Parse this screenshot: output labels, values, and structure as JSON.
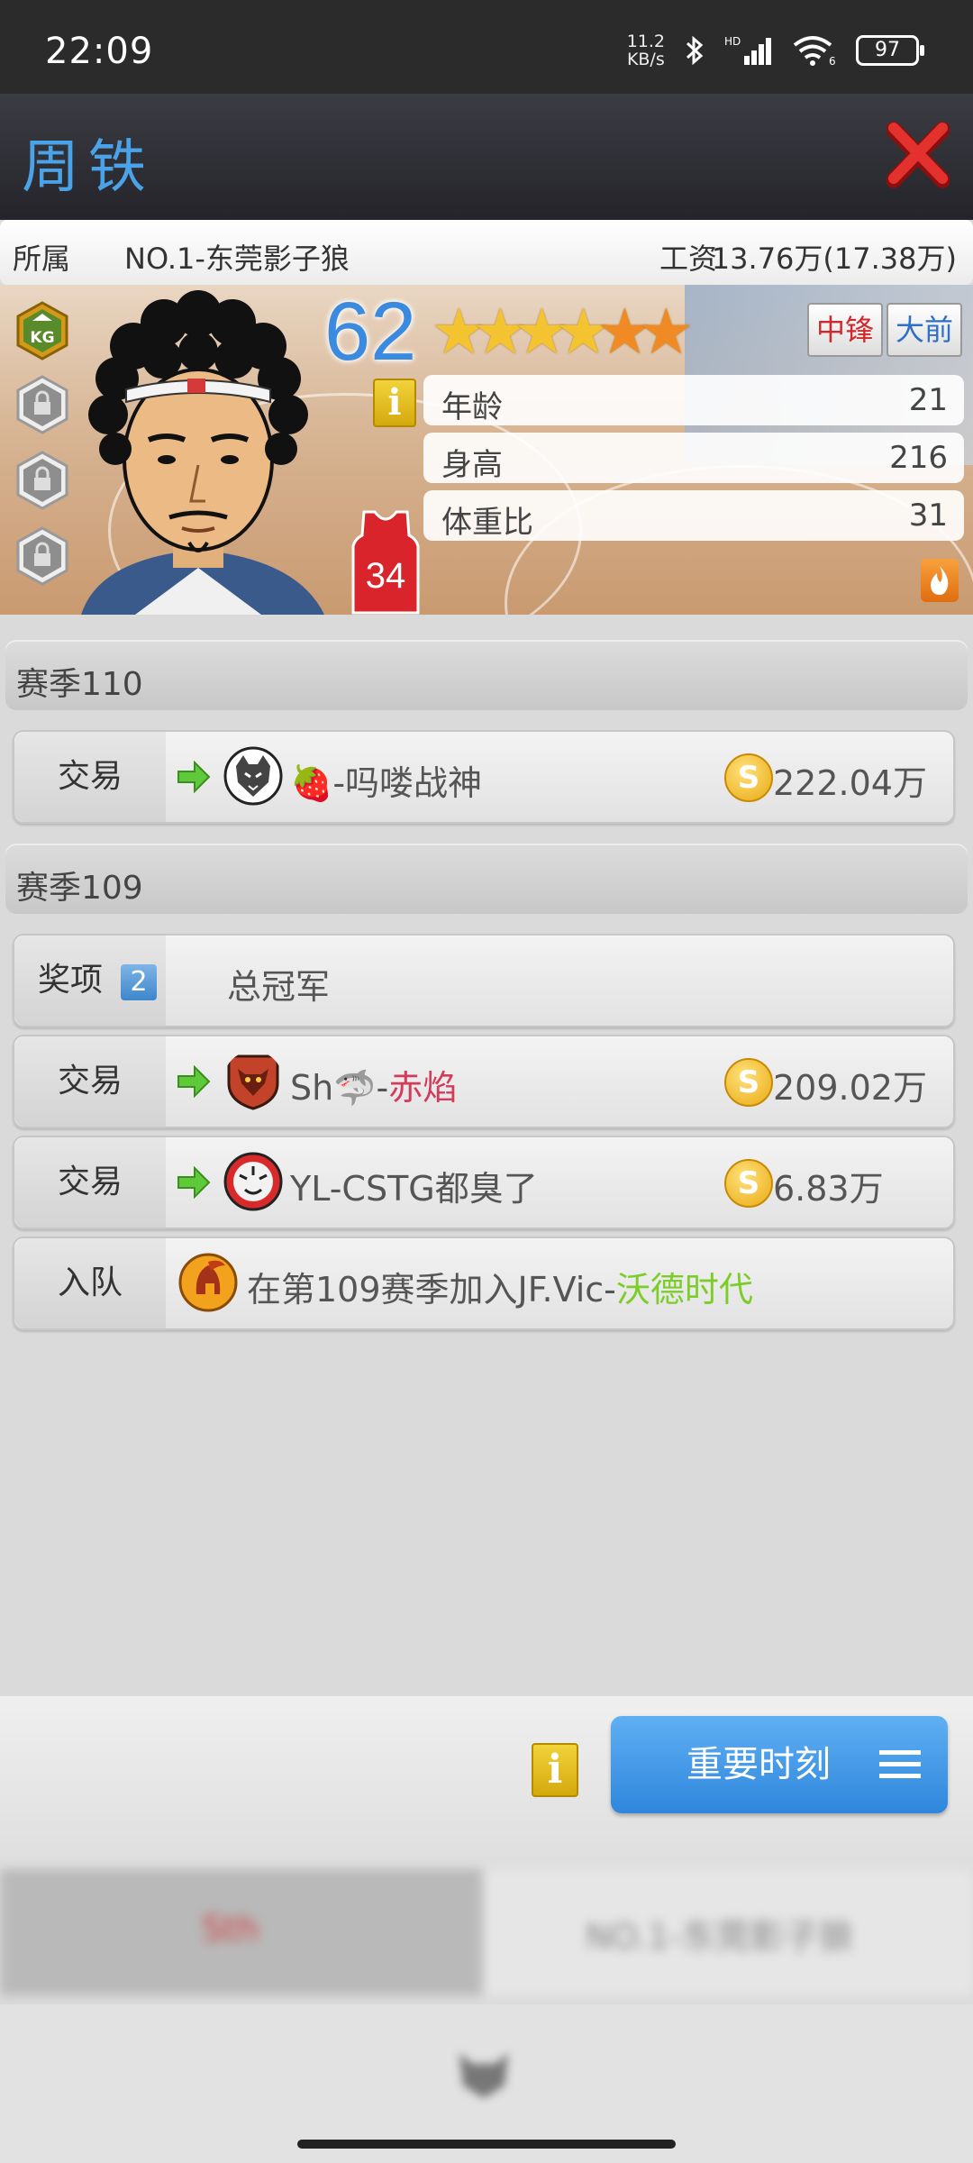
{
  "status_bar": {
    "time": "22:09",
    "net_speed_value": "11.2",
    "net_speed_unit": "KB/s",
    "battery": "97"
  },
  "header": {
    "player_name": "周铁"
  },
  "team_info": {
    "team_label": "所属",
    "team_name": "NO.1-东莞影子狼",
    "salary_label": "工资",
    "salary_value": "13.76万(17.38万)"
  },
  "player_card": {
    "rating": "62",
    "stars_gold": 4,
    "stars_orange": 2,
    "star_char": "★",
    "positions": [
      "中锋",
      "大前"
    ],
    "info_icon": "i",
    "badge_top": "KG",
    "jersey_number": "34",
    "stats": [
      {
        "label": "年龄",
        "value": "21"
      },
      {
        "label": "身高",
        "value": "216"
      },
      {
        "label": "体重比",
        "value": "31"
      }
    ]
  },
  "history": {
    "seasons": [
      {
        "title": "赛季110",
        "events": [
          {
            "type": "交易",
            "team_prefix": "🍓",
            "team": "-吗喽战神",
            "amount": "222.04万"
          }
        ]
      },
      {
        "title": "赛季109",
        "events": [
          {
            "type": "奖项",
            "count": "2",
            "text": "总冠军"
          },
          {
            "type": "交易",
            "team_prefix": "Sh🦈-",
            "team": "赤焰",
            "amount": "209.02万"
          },
          {
            "type": "交易",
            "team": "YL-CSTG都臭了",
            "amount": "6.83万"
          },
          {
            "type": "入队",
            "text_prefix": "在第109赛季加入JF.Vic-",
            "team": "沃德时代"
          }
        ]
      }
    ]
  },
  "coin_symbol": "S",
  "bottom": {
    "moments_button": "重要时刻",
    "info_icon": "i"
  },
  "tabs": {
    "left": "Sth",
    "right": "NO.1-东莞影子狼"
  },
  "colors": {
    "accent_blue": "#3a8be0",
    "gold": "#e9a914",
    "red_team": "#d43a5a",
    "green_team": "#7ccc2a"
  }
}
